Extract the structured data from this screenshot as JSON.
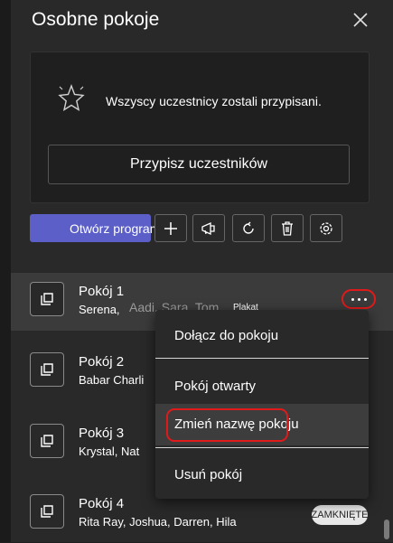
{
  "header": {
    "title": "Osobne pokoje"
  },
  "notice": {
    "message": "Wszyscy uczestnicy zostali przypisani.",
    "assign_label": "Przypisz uczestników"
  },
  "toolbar": {
    "open_label": "Otwórz program",
    "icons": [
      "add-icon",
      "announce-icon",
      "refresh-icon",
      "delete-icon",
      "settings-icon"
    ]
  },
  "rooms": [
    {
      "name": "Pokój 1",
      "members": "Serena,",
      "ghost_members": "Aadi, Sara, Tom",
      "ghost_tag": "Plakat"
    },
    {
      "name": "Pokój 2",
      "members": "Babar Charli"
    },
    {
      "name": "Pokój 3",
      "members": "Krystal, Nat"
    },
    {
      "name": "Pokój 4",
      "members": "Rita Ray, Joshua, Darren, Hila",
      "status": "ZAMKNIĘTE"
    }
  ],
  "context_menu": {
    "items": [
      {
        "label": "Dołącz do pokoju"
      },
      {
        "label": "Pokój otwarty"
      },
      {
        "label": "Zmień nazwę pokoju"
      },
      {
        "label": "Usuń pokój"
      }
    ]
  },
  "colors": {
    "accent": "#5b5fc7",
    "highlight": "#e01a1a",
    "background": "#292929"
  }
}
